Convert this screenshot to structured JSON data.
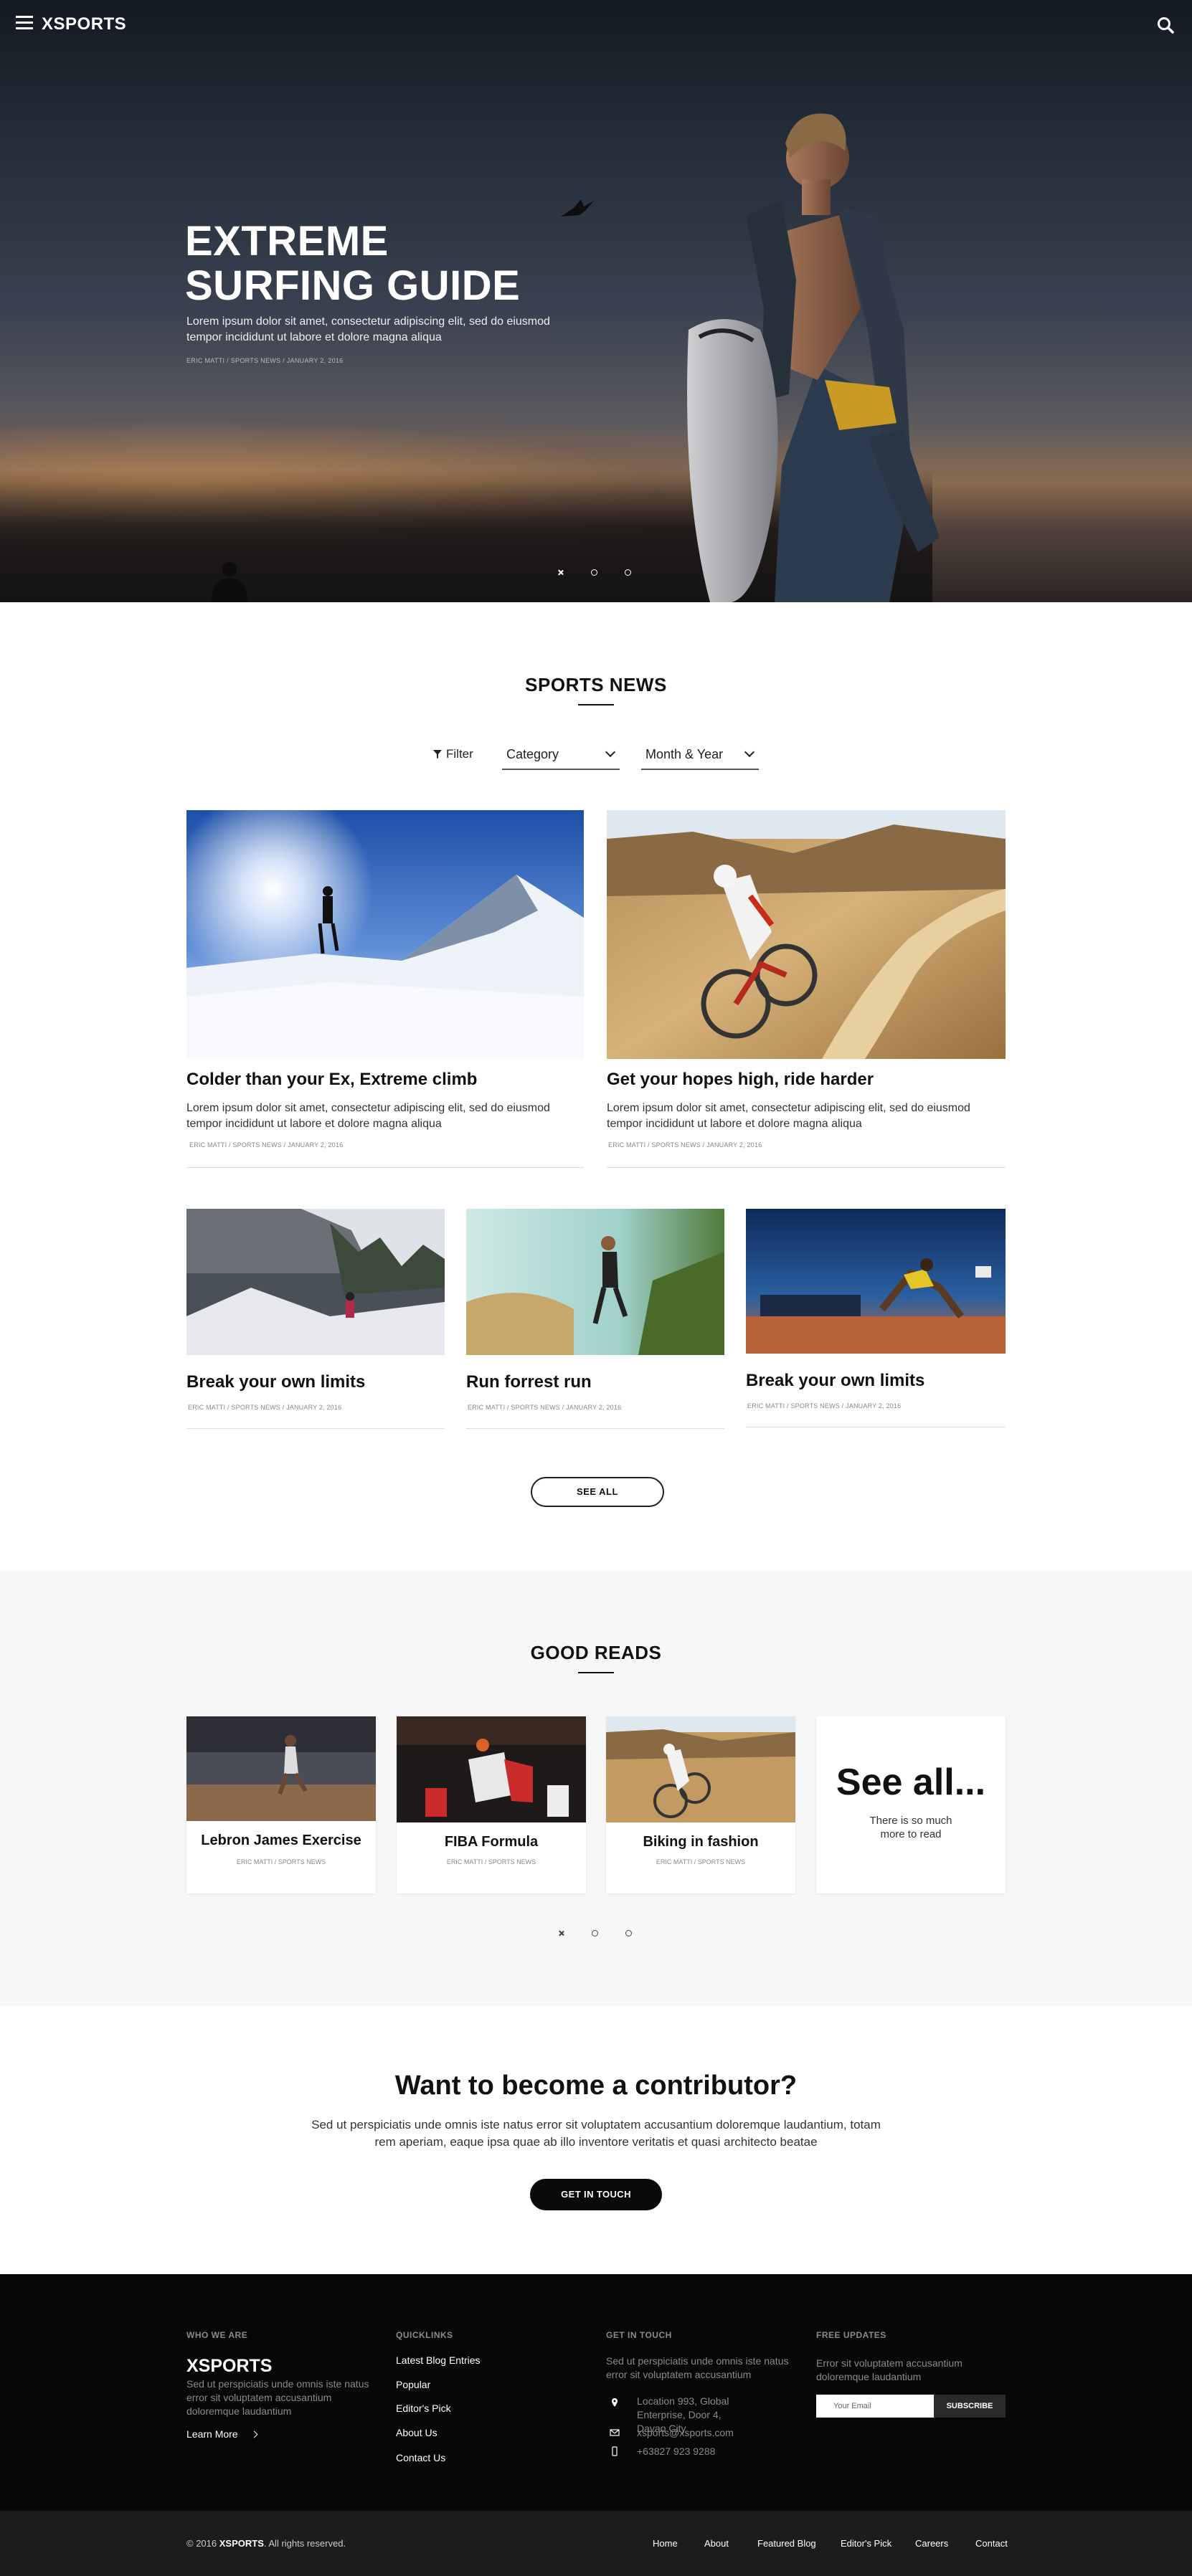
{
  "header": {
    "logo": "XSPORTS"
  },
  "hero": {
    "title": "EXTREME SURFING GUIDE",
    "text": "Lorem ipsum dolor sit amet, consectetur adipiscing elit, sed do eiusmod tempor incididunt ut labore et dolore magna aliqua",
    "meta": "ERIC MATTI / SPORTS NEWS / JANUARY 2, 2016"
  },
  "news": {
    "title": "SPORTS NEWS",
    "filter_label": "Filter",
    "category": "Category",
    "month_year": "Month & Year",
    "featured": [
      {
        "title": "Colder than your Ex, Extreme climb",
        "text": "Lorem ipsum dolor sit amet, consectetur adipiscing elit, sed do eiusmod tempor incididunt ut labore et dolore magna aliqua",
        "meta": "ERIC MATTI / SPORTS NEWS / JANUARY 2, 2016"
      },
      {
        "title": "Get your hopes high, ride harder",
        "text": "Lorem ipsum dolor sit amet, consectetur adipiscing elit, sed do eiusmod tempor incididunt ut labore et dolore magna aliqua",
        "meta": "ERIC MATTI / SPORTS NEWS / JANUARY 2, 2016"
      }
    ],
    "small": [
      {
        "title": "Break your own limits",
        "meta": "ERIC MATTI / SPORTS NEWS / JANUARY 2, 2016"
      },
      {
        "title": "Run forrest run",
        "meta": "ERIC MATTI / SPORTS NEWS / JANUARY 2, 2016"
      },
      {
        "title": "Break your own limits",
        "meta": "ERIC MATTI / SPORTS NEWS / JANUARY 2, 2016"
      }
    ],
    "see_all": "SEE ALL"
  },
  "reads": {
    "title": "GOOD READS",
    "cards": [
      {
        "title": "Lebron James Exercise",
        "meta": "ERIC MATTI / SPORTS NEWS"
      },
      {
        "title": "FIBA Formula",
        "meta": "ERIC MATTI / SPORTS NEWS"
      },
      {
        "title": "Biking in fashion",
        "meta": "ERIC MATTI / SPORTS NEWS"
      }
    ],
    "see_all_title": "See all...",
    "see_all_text": "There is so much more to read"
  },
  "contributor": {
    "title": "Want to become a contributor?",
    "text": "Sed ut perspiciatis unde omnis iste natus error sit voluptatem accusantium doloremque laudantium, totam rem aperiam, eaque ipsa quae ab illo inventore veritatis et quasi architecto beatae",
    "button": "GET IN TOUCH"
  },
  "footer": {
    "who_head": "WHO WE ARE",
    "logo": "XSPORTS",
    "who_text": "Sed ut perspiciatis unde omnis iste natus error sit voluptatem accusantium doloremque laudantium",
    "learn_more": "Learn More",
    "quick_head": "QUICKLINKS",
    "quicklinks": [
      "Latest Blog Entries",
      "Popular",
      "Editor's Pick",
      "About Us",
      "Contact Us"
    ],
    "touch_head": "GET IN TOUCH",
    "touch_text": "Sed ut perspiciatis unde omnis iste natus error sit voluptatem accusantium",
    "location": "Location 993, Global Enterprise, Door 4, Davao City",
    "email": "xsports@xsports.com",
    "phone": "+63827 923 9288",
    "updates_head": "FREE UPDATES",
    "updates_text": "Error sit voluptatem accusantium doloremque laudantium",
    "email_placeholder": "Your Email",
    "subscribe": "SUBSCRIBE"
  },
  "bottom": {
    "copyright_prefix": "© 2016",
    "copyright_brand": "XSPORTS",
    "copyright_suffix": ". All rights reserved.",
    "links": [
      "Home",
      "About",
      "Featured Blog",
      "Editor's Pick",
      "Careers",
      "Contact"
    ]
  }
}
